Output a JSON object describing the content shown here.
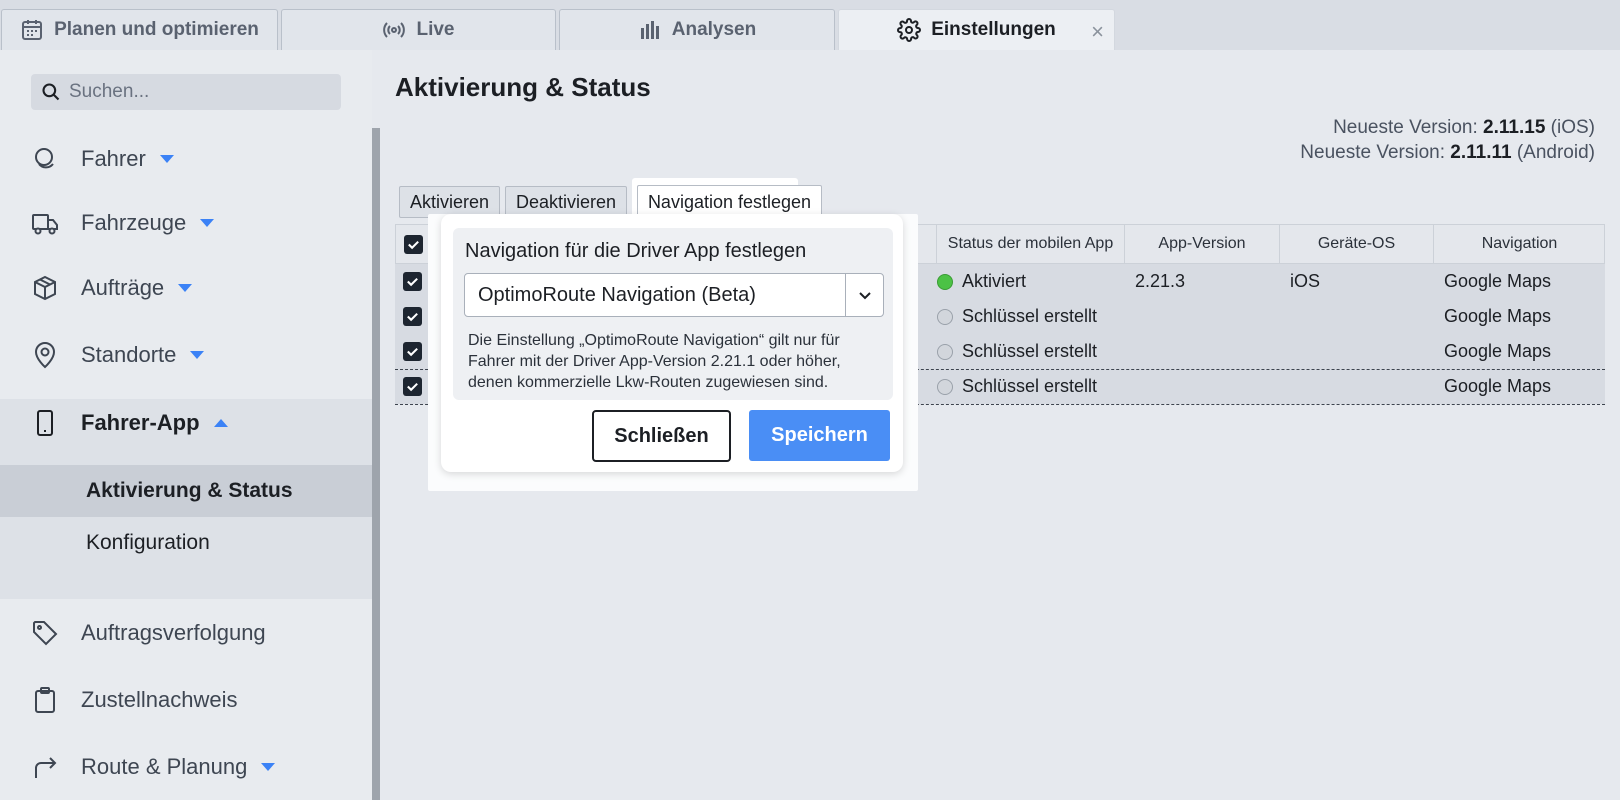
{
  "tabs": [
    {
      "label": "Planen und optimieren",
      "icon": "calendar-icon"
    },
    {
      "label": "Live",
      "icon": "broadcast-icon"
    },
    {
      "label": "Analysen",
      "icon": "bar-chart-icon"
    },
    {
      "label": "Einstellungen",
      "icon": "gear-icon",
      "active": true
    }
  ],
  "tab_close": "×",
  "sidebar": {
    "search_placeholder": "Suchen...",
    "items": [
      {
        "label": "Fahrer",
        "icon": "driver-icon"
      },
      {
        "label": "Fahrzeuge",
        "icon": "truck-icon"
      },
      {
        "label": "Aufträge",
        "icon": "box-icon"
      },
      {
        "label": "Standorte",
        "icon": "location-pin-icon"
      },
      {
        "label": "Fahrer-App",
        "icon": "phone-icon"
      },
      {
        "label": "Auftragsverfolgung",
        "icon": "tag-icon"
      },
      {
        "label": "Zustellnachweis",
        "icon": "clipboard-icon"
      },
      {
        "label": "Route & Planung",
        "icon": "route-arrow-icon"
      }
    ],
    "sub_items": [
      {
        "label": "Aktivierung & Status",
        "active": true
      },
      {
        "label": "Konfiguration"
      }
    ]
  },
  "main": {
    "title": "Aktivierung & Status",
    "version_label": "Neueste Version:",
    "version_ios": "2.11.15",
    "version_ios_os": "(iOS)",
    "version_android": "2.11.11",
    "version_android_os": "(Android)",
    "actions": [
      "Aktivieren",
      "Deaktivieren",
      "Navigation festlegen"
    ]
  },
  "table": {
    "headers": [
      "Status der mobilen App",
      "App-Version",
      "Geräte-OS",
      "Navigation"
    ],
    "rows": [
      {
        "status": "Aktiviert",
        "status_color": "green",
        "app_version": "2.21.3",
        "os": "iOS",
        "navigation": "Google Maps",
        "truncated": ""
      },
      {
        "status": "Schlüssel erstellt",
        "status_color": "gray",
        "app_version": "",
        "os": "",
        "navigation": "Google Maps",
        "truncated": "..."
      },
      {
        "status": "Schlüssel erstellt",
        "status_color": "gray",
        "app_version": "",
        "os": "",
        "navigation": "Google Maps",
        "truncated": "..."
      },
      {
        "status": "Schlüssel erstellt",
        "status_color": "gray",
        "app_version": "",
        "os": "",
        "navigation": "Google Maps",
        "truncated": "..."
      }
    ]
  },
  "dialog": {
    "title": "Navigation für die Driver App festlegen",
    "selected": "OptimoRoute Navigation (Beta)",
    "note": "Die Einstellung „OptimoRoute Navigation“ gilt nur für Fahrer mit der Driver App-Version 2.21.1 oder höher, denen kommerzielle Lkw-Routen zugewiesen sind.",
    "close_label": "Schließen",
    "save_label": "Speichern"
  },
  "colors": {
    "accent": "#3b82f6",
    "save_button": "#4a8ef5",
    "status_green": "#4cc245"
  }
}
